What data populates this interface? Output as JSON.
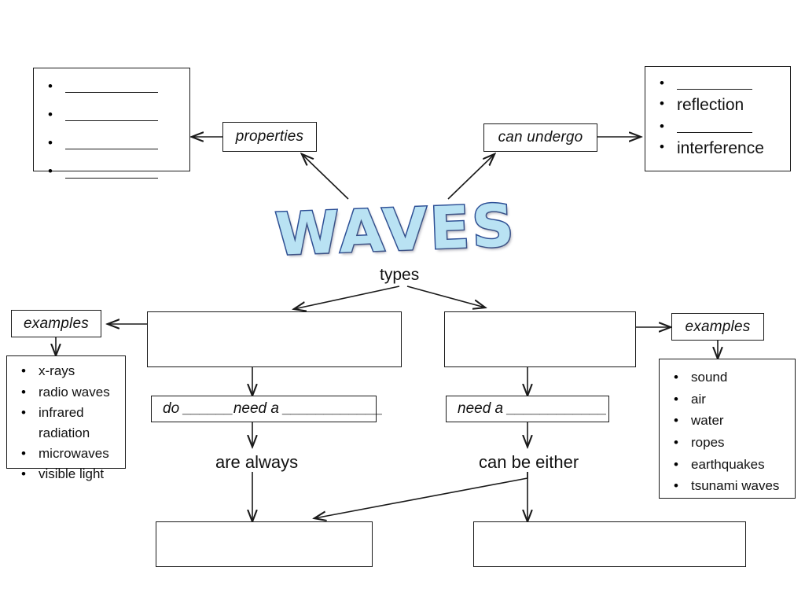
{
  "diagram": {
    "title": "WAVES",
    "center_label_types": "types"
  },
  "top_left": {
    "connector_label": "properties",
    "items": [
      {
        "text": "",
        "blank": true
      },
      {
        "text": "",
        "blank": true
      },
      {
        "text": "",
        "blank": true
      },
      {
        "text": "",
        "blank": true
      }
    ]
  },
  "top_right": {
    "connector_label": "can undergo",
    "items": [
      {
        "text": "",
        "blank": true
      },
      {
        "text": "reflection",
        "blank": false
      },
      {
        "text": "",
        "blank": true
      },
      {
        "text": "interference",
        "blank": false
      }
    ]
  },
  "types": {
    "left_box_value": "",
    "right_box_value": "",
    "left_examples_label": "examples",
    "right_examples_label": "examples"
  },
  "left_branch": {
    "medium_question": "do ______need a ____________",
    "state_label": "are always",
    "answer_box_value": "",
    "examples": [
      "x-rays",
      "radio waves",
      "infrared",
      "radiation",
      "microwaves",
      "visible light"
    ],
    "example_bullets": [
      true,
      true,
      true,
      false,
      true,
      true
    ]
  },
  "right_branch": {
    "medium_question": "need a ____________",
    "state_label": "can be either",
    "answer_box_value": "",
    "examples": [
      "sound",
      "air",
      "water",
      "ropes",
      "earthquakes",
      "tsunami waves"
    ],
    "example_bullets": [
      true,
      true,
      true,
      true,
      true,
      true
    ]
  },
  "colors": {
    "line": "#1a1a1a",
    "title_fill": "#b9e2f3",
    "title_outline": "#2c4f96",
    "background": "#ffffff"
  },
  "icons": {
    "bullet": "•"
  }
}
